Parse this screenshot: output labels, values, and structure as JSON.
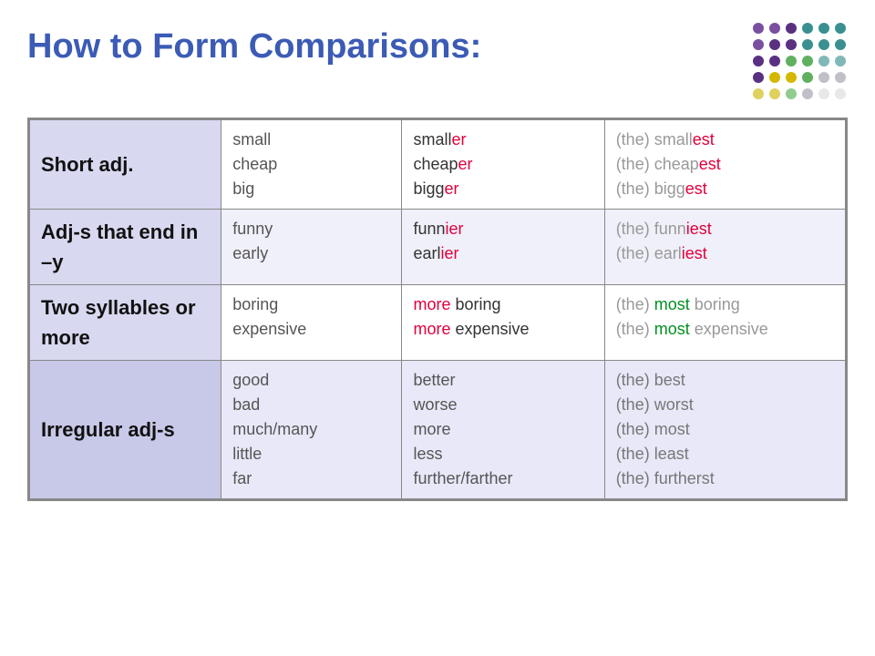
{
  "header": {
    "title": "How to Form Comparisons:"
  },
  "dots": [
    [
      "d-purple",
      "d-purple",
      "d-dpurple",
      "d-teal",
      "d-teal",
      "d-teal"
    ],
    [
      "d-purple",
      "d-dpurple",
      "d-dpurple",
      "d-teal",
      "d-teal",
      "d-teal"
    ],
    [
      "d-dpurple",
      "d-dpurple",
      "d-green",
      "d-green",
      "d-lteal",
      "d-lteal"
    ],
    [
      "d-dpurple",
      "d-yellow",
      "d-yellow",
      "d-green",
      "d-lgray",
      "d-lgray"
    ],
    [
      "d-lyellow",
      "d-lyellow",
      "d-lgreen",
      "d-lgray",
      "d-white",
      "d-white"
    ]
  ],
  "rows": [
    {
      "category": "Short adj.",
      "base": "small\ncheap\nbig",
      "comparative": "smaller\ncheaper\nbigger",
      "superlative": "(the) smallest\n(the) cheapest\n(the) biggest",
      "shaded": false
    },
    {
      "category": "Adj-s that end in –y",
      "base": "funny\nearly",
      "comparative": "funnier\nearlier",
      "superlative": "(the) funniest\n(the) earliest",
      "shaded": true
    },
    {
      "category": "Two syllables or more",
      "base": "boring\nexpensive",
      "comparative": "more boring\nmore expensive",
      "superlative": "(the) most boring\n(the) most expensive",
      "shaded": false,
      "moreHighlight": true
    },
    {
      "category": "Irregular adj-s",
      "base": "good\nbad\nmuch/many\nlittle\nfar",
      "comparative": "better\nworse\nmore\nless\nfurther/farther",
      "superlative": "(the) best\n(the) worst\n(the) most\n(the) least\n(the) furtherst",
      "shaded": true,
      "irregular": true
    }
  ]
}
